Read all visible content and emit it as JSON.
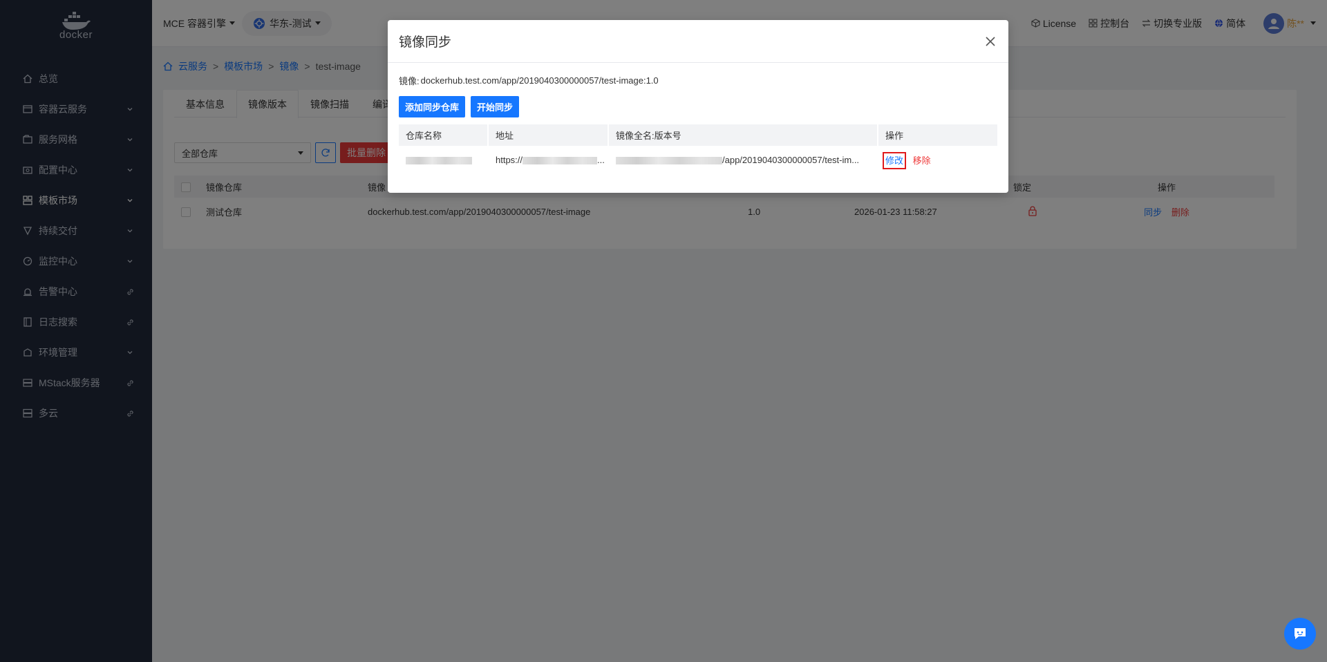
{
  "logo": {
    "text": "docker"
  },
  "sidebar": {
    "items": [
      {
        "label": "总览",
        "icon": "home-icon",
        "tail": ""
      },
      {
        "label": "容器云服务",
        "icon": "container-icon",
        "tail": "chevron-down-icon"
      },
      {
        "label": "服务网格",
        "icon": "mesh-icon",
        "tail": "chevron-down-icon"
      },
      {
        "label": "配置中心",
        "icon": "config-icon",
        "tail": "chevron-down-icon"
      },
      {
        "label": "模板市场",
        "icon": "template-icon",
        "tail": "chevron-down-icon",
        "active": true
      },
      {
        "label": "持续交付",
        "icon": "delivery-icon",
        "tail": "chevron-down-icon"
      },
      {
        "label": "监控中心",
        "icon": "monitor-icon",
        "tail": "chevron-down-icon"
      },
      {
        "label": "告警中心",
        "icon": "alarm-icon",
        "tail": "link-icon"
      },
      {
        "label": "日志搜索",
        "icon": "log-icon",
        "tail": "link-icon"
      },
      {
        "label": "环境管理",
        "icon": "env-icon",
        "tail": "chevron-down-icon"
      },
      {
        "label": "MStack服务器",
        "icon": "server-icon",
        "tail": "link-icon"
      },
      {
        "label": "多云",
        "icon": "cloud-icon",
        "tail": "link-icon"
      }
    ]
  },
  "topbar": {
    "engine": "MCE 容器引擎",
    "region": "华东-测试",
    "license": "License",
    "console": "控制台",
    "switch_pro": "切换专业版",
    "language": "简体",
    "username": "陈**"
  },
  "breadcrumb": {
    "items": [
      "云服务",
      "模板市场",
      "镜像"
    ],
    "current": "test-image",
    "separator": ">"
  },
  "tabs": [
    "基本信息",
    "镜像版本",
    "镜像扫描",
    "编译"
  ],
  "filters": {
    "repo_select": "全部仓库",
    "batch_delete": "批量删除"
  },
  "main_table": {
    "headers": [
      "镜像仓库",
      "镜像",
      "",
      "",
      "锁定",
      "操作"
    ],
    "rows": [
      {
        "repo": "测试仓库",
        "image": "dockerhub.test.com/app/2019040300000057/test-image",
        "version": "1.0",
        "time": "2026-01-23 11:58:27",
        "sync": "同步",
        "delete": "删除"
      }
    ]
  },
  "modal": {
    "title": "镜像同步",
    "image_label": "镜像:",
    "image_value": "dockerhub.test.com/app/2019040300000057/test-image:1.0",
    "add_button": "添加同步仓库",
    "start_button": "开始同步",
    "headers": [
      "仓库名称",
      "地址",
      "镜像全名:版本号",
      "操作"
    ],
    "rows": [
      {
        "address_prefix": "https://",
        "address_suffix": "...",
        "fullname_suffix": "/app/2019040300000057/test-im...",
        "edit": "修改",
        "remove": "移除"
      }
    ]
  },
  "colors": {
    "primary": "#1677ff",
    "danger": "#ee3a3a",
    "sidebar": "#222a3d",
    "highlight": "#e0191b"
  }
}
